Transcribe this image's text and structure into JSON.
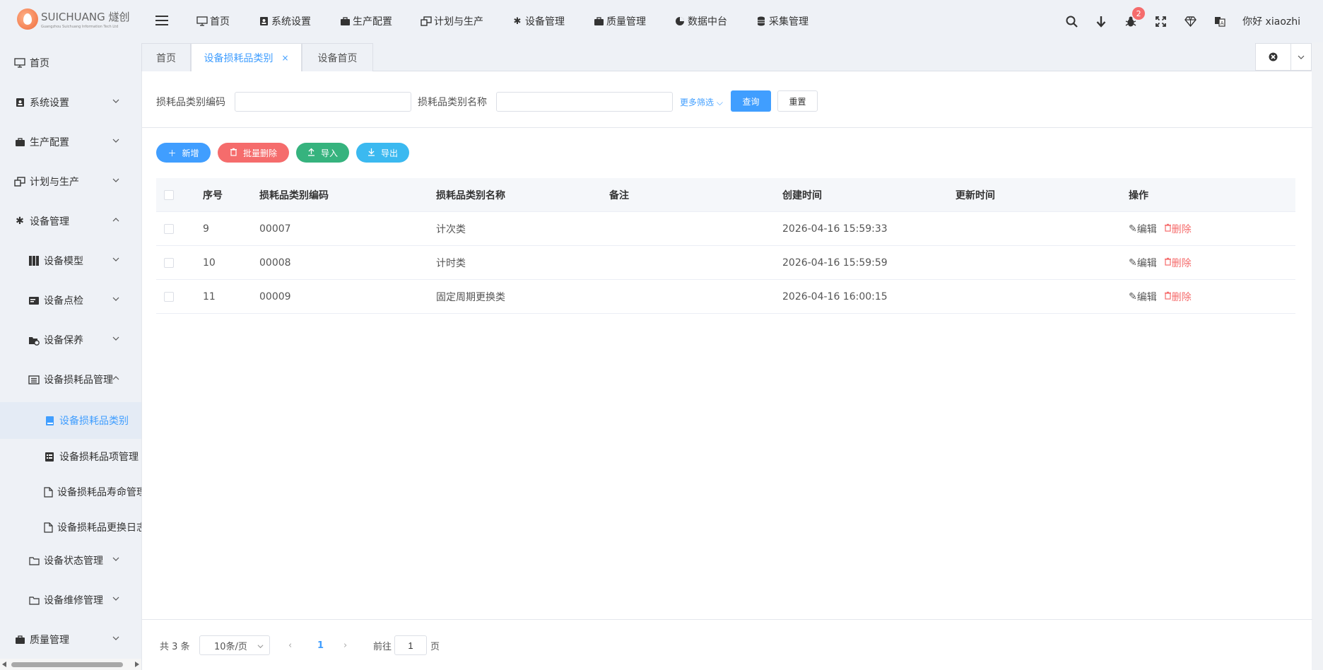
{
  "header": {
    "logo_main": "SUICHUANG 燧创",
    "logo_sub": "Guangzhou Suichuang Information Tech Ltd",
    "nav": [
      {
        "label": "首页",
        "icon": "monitor-icon"
      },
      {
        "label": "系统设置",
        "icon": "user-card-icon"
      },
      {
        "label": "生产配置",
        "icon": "briefcase-icon"
      },
      {
        "label": "计划与生产",
        "icon": "windows-icon"
      },
      {
        "label": "设备管理",
        "icon": "asterisk-icon"
      },
      {
        "label": "质量管理",
        "icon": "briefcase-icon"
      },
      {
        "label": "数据中台",
        "icon": "pie-chart-icon"
      },
      {
        "label": "采集管理",
        "icon": "database-icon"
      }
    ],
    "notification_count": "2",
    "greeting": "你好 xiaozhi"
  },
  "sidebar": {
    "items": [
      {
        "label": "首页",
        "icon": "monitor-icon"
      },
      {
        "label": "系统设置",
        "icon": "user-card-icon"
      },
      {
        "label": "生产配置",
        "icon": "briefcase-icon"
      },
      {
        "label": "计划与生产",
        "icon": "windows-icon"
      },
      {
        "label": "设备管理",
        "icon": "asterisk-icon"
      },
      {
        "label": "设备模型",
        "icon": "columns-icon"
      },
      {
        "label": "设备点检",
        "icon": "card-icon"
      },
      {
        "label": "设备保养",
        "icon": "folder-gear-icon"
      },
      {
        "label": "设备损耗品管理",
        "icon": "list-icon"
      },
      {
        "label": "设备损耗品类别",
        "icon": "book-icon"
      },
      {
        "label": "设备损耗品项管理",
        "icon": "list-box-icon"
      },
      {
        "label": "设备损耗品寿命管理",
        "icon": "document-icon"
      },
      {
        "label": "设备损耗品更换日志",
        "icon": "document-icon"
      },
      {
        "label": "设备状态管理",
        "icon": "folder-icon"
      },
      {
        "label": "设备维修管理",
        "icon": "folder-icon"
      },
      {
        "label": "质量管理",
        "icon": "briefcase-icon"
      }
    ]
  },
  "tabs": [
    {
      "label": "首页"
    },
    {
      "label": "设备损耗品类别",
      "close": "×"
    },
    {
      "label": "设备首页"
    }
  ],
  "filter": {
    "code_label": "损耗品类别编码",
    "code_value": "",
    "name_label": "损耗品类别名称",
    "name_value": "",
    "more_label": "更多筛选",
    "query_label": "查询",
    "reset_label": "重置"
  },
  "actions": {
    "add_label": "新增",
    "batch_delete_label": "批量删除",
    "import_label": "导入",
    "export_label": "导出",
    "add_color": "#409eff",
    "delete_color": "#f56c6c",
    "import_color": "#36b37e",
    "export_color": "#3bb9f0"
  },
  "table": {
    "columns": [
      "序号",
      "损耗品类别编码",
      "损耗品类别名称",
      "备注",
      "创建时间",
      "更新时间",
      "操作"
    ],
    "rows": [
      {
        "index": "9",
        "code": "00007",
        "name": "计次类",
        "remark": "",
        "created": "2026-04-16 15:59:33",
        "updated": ""
      },
      {
        "index": "10",
        "code": "00008",
        "name": "计时类",
        "remark": "",
        "created": "2026-04-16 15:59:59",
        "updated": ""
      },
      {
        "index": "11",
        "code": "00009",
        "name": "固定周期更换类",
        "remark": "",
        "created": "2026-04-16 16:00:15",
        "updated": ""
      }
    ],
    "edit_label": "编辑",
    "delete_label": "删除"
  },
  "pagination": {
    "total_text": "共 3 条",
    "page_size": "10条/页",
    "current_page": "1",
    "goto_label": "前往",
    "goto_value": "1",
    "page_suffix": "页"
  }
}
